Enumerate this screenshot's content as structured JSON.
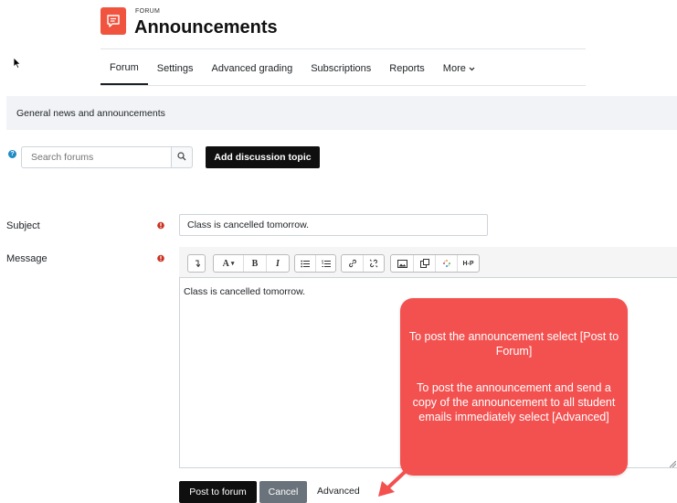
{
  "header": {
    "category": "FORUM",
    "title": "Announcements"
  },
  "nav": {
    "items": [
      {
        "label": "Forum",
        "active": true
      },
      {
        "label": "Settings"
      },
      {
        "label": "Advanced grading"
      },
      {
        "label": "Subscriptions"
      },
      {
        "label": "Reports"
      },
      {
        "label": "More"
      }
    ]
  },
  "intro": {
    "text": "General news and announcements"
  },
  "search": {
    "placeholder": "Search forums",
    "add_topic_label": "Add discussion topic"
  },
  "form": {
    "subject_label": "Subject",
    "subject_value": "Class is cancelled tomorrow.",
    "message_label": "Message",
    "message_body": "Class is cancelled tomorrow.",
    "toolbar": {
      "font_label": "A",
      "bold": "B",
      "italic": "I",
      "h5p": "H-P"
    },
    "post_label": "Post to forum",
    "cancel_label": "Cancel",
    "advanced_label": "Advanced"
  },
  "callout": {
    "line1": "To post the announcement select [Post to Forum]",
    "line2": "To post the announcement and send a copy of the announcement to all student emails immediately select [Advanced]"
  },
  "colors": {
    "accent": "#f0543e",
    "callout": "#f35150",
    "primary_button": "#0f0f0f",
    "secondary_button": "#6a737b",
    "required": "#ca3120",
    "help": "#1f8bc4"
  }
}
